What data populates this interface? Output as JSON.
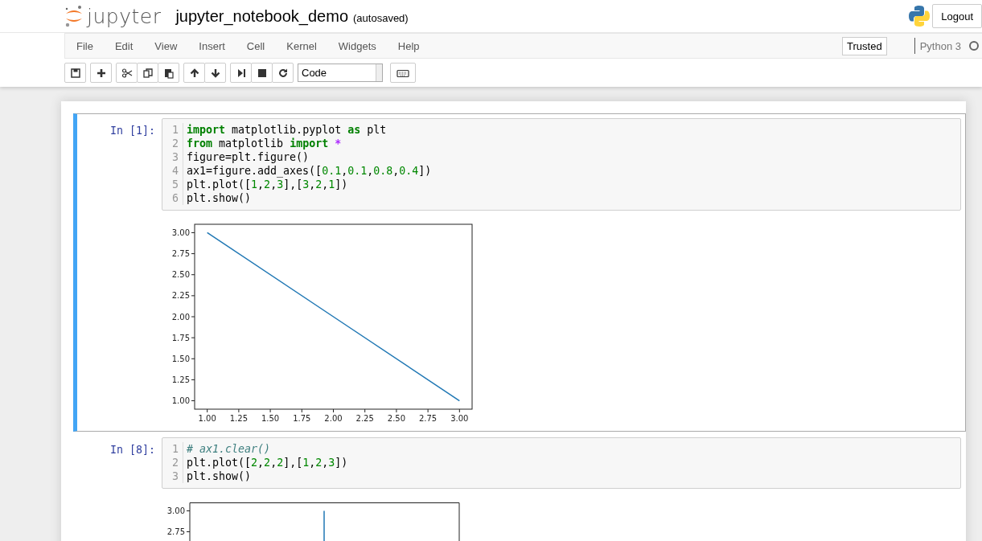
{
  "header": {
    "logo_text": "jupyter",
    "notebook_name": "jupyter_notebook_demo",
    "save_status": "(autosaved)",
    "logout": "Logout"
  },
  "menubar": {
    "items": [
      "File",
      "Edit",
      "View",
      "Insert",
      "Cell",
      "Kernel",
      "Widgets",
      "Help"
    ],
    "trusted": "Trusted",
    "kernel": {
      "name": "Python 3",
      "busy": false
    }
  },
  "toolbar": {
    "cell_type": "Code"
  },
  "cells": [
    {
      "prompt": "In [1]:",
      "selected": true,
      "code": [
        [
          {
            "text": "import",
            "kind": "keyword"
          },
          {
            "text": " matplotlib.pyplot ",
            "kind": "plain"
          },
          {
            "text": "as",
            "kind": "keyword"
          },
          {
            "text": " plt",
            "kind": "plain"
          }
        ],
        [
          {
            "text": "from",
            "kind": "keyword"
          },
          {
            "text": " matplotlib ",
            "kind": "plain"
          },
          {
            "text": "import",
            "kind": "keyword"
          },
          {
            "text": " *",
            "kind": "operator"
          }
        ],
        [
          {
            "text": "figure=plt.figure()",
            "kind": "plain"
          }
        ],
        [
          {
            "text": "ax1=figure.add_axes([",
            "kind": "plain"
          },
          {
            "text": "0.1",
            "kind": "number"
          },
          {
            "text": ",",
            "kind": "plain"
          },
          {
            "text": "0.1",
            "kind": "number"
          },
          {
            "text": ",",
            "kind": "plain"
          },
          {
            "text": "0.8",
            "kind": "number"
          },
          {
            "text": ",",
            "kind": "plain"
          },
          {
            "text": "0.4",
            "kind": "number"
          },
          {
            "text": "])",
            "kind": "plain"
          }
        ],
        [
          {
            "text": "plt.plot([",
            "kind": "plain"
          },
          {
            "text": "1",
            "kind": "number"
          },
          {
            "text": ",",
            "kind": "plain"
          },
          {
            "text": "2",
            "kind": "number"
          },
          {
            "text": ",",
            "kind": "plain"
          },
          {
            "text": "3",
            "kind": "number"
          },
          {
            "text": "],[",
            "kind": "plain"
          },
          {
            "text": "3",
            "kind": "number"
          },
          {
            "text": ",",
            "kind": "plain"
          },
          {
            "text": "2",
            "kind": "number"
          },
          {
            "text": ",",
            "kind": "plain"
          },
          {
            "text": "1",
            "kind": "number"
          },
          {
            "text": "])",
            "kind": "plain"
          }
        ],
        [
          {
            "text": "plt.show()",
            "kind": "plain"
          }
        ]
      ],
      "line_numbers": [
        "1",
        "2",
        "3",
        "4",
        "5",
        "6"
      ],
      "output": {
        "chart_data": {
          "type": "line",
          "x": [
            1,
            2,
            3
          ],
          "series": [
            {
              "color": "#1f77b4",
              "values": [
                3,
                2,
                1
              ]
            }
          ],
          "xlim": [
            0.9,
            3.1
          ],
          "ylim": [
            0.9,
            3.1
          ],
          "xticks": [
            {
              "value": 1,
              "label": "1.00"
            },
            {
              "value": 1.25,
              "label": "1.25"
            },
            {
              "value": 1.5,
              "label": "1.50"
            },
            {
              "value": 1.75,
              "label": "1.75"
            },
            {
              "value": 2,
              "label": "2.00"
            },
            {
              "value": 2.25,
              "label": "2.25"
            },
            {
              "value": 2.5,
              "label": "2.50"
            },
            {
              "value": 2.75,
              "label": "2.75"
            },
            {
              "value": 3,
              "label": "3.00"
            }
          ],
          "yticks": [
            {
              "value": 1,
              "label": "1.00"
            },
            {
              "value": 1.25,
              "label": "1.25"
            },
            {
              "value": 1.5,
              "label": "1.50"
            },
            {
              "value": 1.75,
              "label": "1.75"
            },
            {
              "value": 2,
              "label": "2.00"
            },
            {
              "value": 2.25,
              "label": "2.25"
            },
            {
              "value": 2.5,
              "label": "2.50"
            },
            {
              "value": 2.75,
              "label": "2.75"
            },
            {
              "value": 3,
              "label": "3.00"
            }
          ]
        }
      }
    },
    {
      "prompt": "In [8]:",
      "selected": false,
      "code": [
        [
          {
            "text": "# ax1.clear()",
            "kind": "comment"
          }
        ],
        [
          {
            "text": "plt.plot([",
            "kind": "plain"
          },
          {
            "text": "2",
            "kind": "number"
          },
          {
            "text": ",",
            "kind": "plain"
          },
          {
            "text": "2",
            "kind": "number"
          },
          {
            "text": ",",
            "kind": "plain"
          },
          {
            "text": "2",
            "kind": "number"
          },
          {
            "text": "],[",
            "kind": "plain"
          },
          {
            "text": "1",
            "kind": "number"
          },
          {
            "text": ",",
            "kind": "plain"
          },
          {
            "text": "2",
            "kind": "number"
          },
          {
            "text": ",",
            "kind": "plain"
          },
          {
            "text": "3",
            "kind": "number"
          },
          {
            "text": "])",
            "kind": "plain"
          }
        ],
        [
          {
            "text": "plt.show()",
            "kind": "plain"
          }
        ]
      ],
      "line_numbers": [
        "1",
        "2",
        "3"
      ],
      "output": {
        "kind": "picture",
        "y_tick_labels": [
          "3.00",
          "2.75"
        ]
      }
    }
  ]
}
